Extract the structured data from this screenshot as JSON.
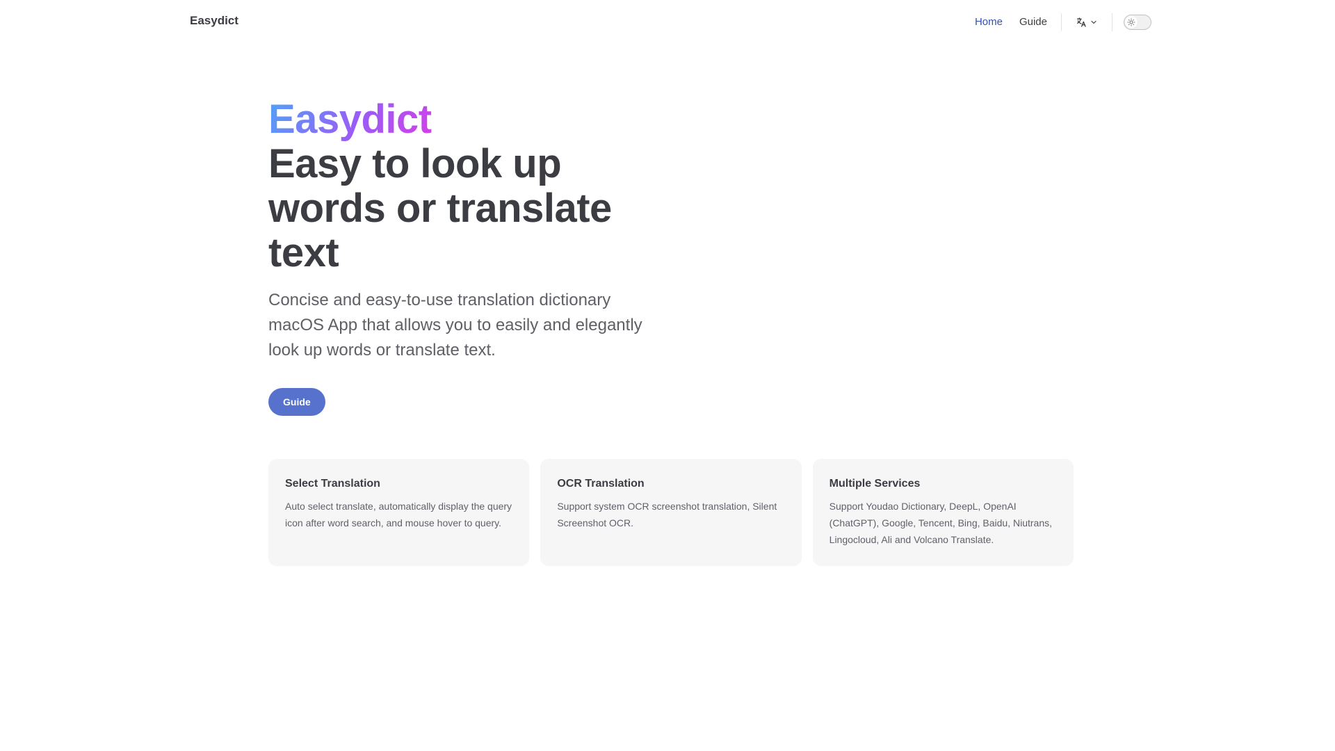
{
  "nav": {
    "brand": "Easydict",
    "links": [
      {
        "label": "Home",
        "active": true
      },
      {
        "label": "Guide",
        "active": false
      }
    ],
    "language_icon": "translate-icon",
    "language_chevron": "chevron-down-icon",
    "appearance_icon": "sun-icon"
  },
  "hero": {
    "name": "Easydict",
    "text": "Easy to look up words or translate text",
    "tagline": "Concise and easy-to-use translation dictionary macOS App that allows you to easily and elegantly look up words or translate text.",
    "action_label": "Guide"
  },
  "features": [
    {
      "title": "Select Translation",
      "details": "Auto select translate, automatically display the query icon after word search, and mouse hover to query."
    },
    {
      "title": "OCR Translation",
      "details": "Support system OCR screenshot translation, Silent Screenshot OCR."
    },
    {
      "title": "Multiple Services",
      "details": "Support Youdao Dictionary, DeepL, OpenAI (ChatGPT), Google, Tencent, Bing, Baidu, Niutrans, Lingocloud, Ali and Volcano Translate."
    }
  ],
  "colors": {
    "brand": "#5672cd",
    "active_link": "#3451b2",
    "text": "#3c3c43",
    "card_bg": "#f6f6f7"
  }
}
